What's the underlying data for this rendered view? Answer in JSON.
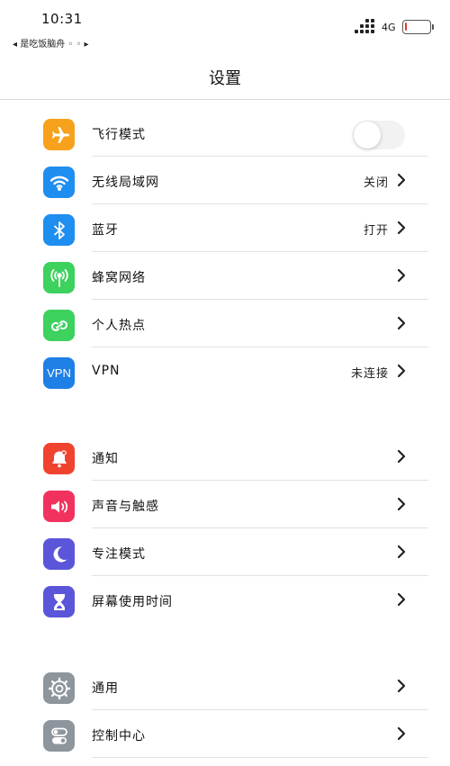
{
  "status": {
    "time": "10:31",
    "back_app": "◂ 是吃饭脑舟 ◦ ◦ ▸",
    "network": "4G",
    "battery_level": 0.05
  },
  "nav": {
    "title": "设置"
  },
  "groups": [
    {
      "rows": [
        {
          "label": "飞行模式",
          "icon": "airplane-icon",
          "color": "#F7A21C",
          "toggle": false
        },
        {
          "label": "无线局域网",
          "icon": "wifi-icon",
          "color": "#1E8EF0",
          "value": "关闭"
        },
        {
          "label": "蓝牙",
          "icon": "bluetooth-icon",
          "color": "#1E8EF0",
          "value": "打开"
        },
        {
          "label": "蜂窝网络",
          "icon": "cellular-icon",
          "color": "#3DD15E",
          "value": ""
        },
        {
          "label": "个人热点",
          "icon": "hotspot-icon",
          "color": "#3DD15E",
          "value": ""
        },
        {
          "label": "VPN",
          "icon": "vpn-icon",
          "icon_text": "VPN",
          "color": "#1E7FE6",
          "value": "未连接"
        }
      ]
    },
    {
      "rows": [
        {
          "label": "通知",
          "icon": "bell-icon",
          "color": "#F0432F",
          "value": ""
        },
        {
          "label": "声音与触感",
          "icon": "speaker-icon",
          "color": "#F2325E",
          "value": ""
        },
        {
          "label": "专注模式",
          "icon": "moon-icon",
          "color": "#5B55DA",
          "value": ""
        },
        {
          "label": "屏幕使用时间",
          "icon": "hourglass-icon",
          "color": "#5B55DA",
          "value": ""
        }
      ]
    },
    {
      "rows": [
        {
          "label": "通用",
          "icon": "gear-icon",
          "color": "#8E959C",
          "value": ""
        },
        {
          "label": "控制中心",
          "icon": "switches-icon",
          "color": "#8E959C",
          "value": ""
        }
      ]
    }
  ]
}
